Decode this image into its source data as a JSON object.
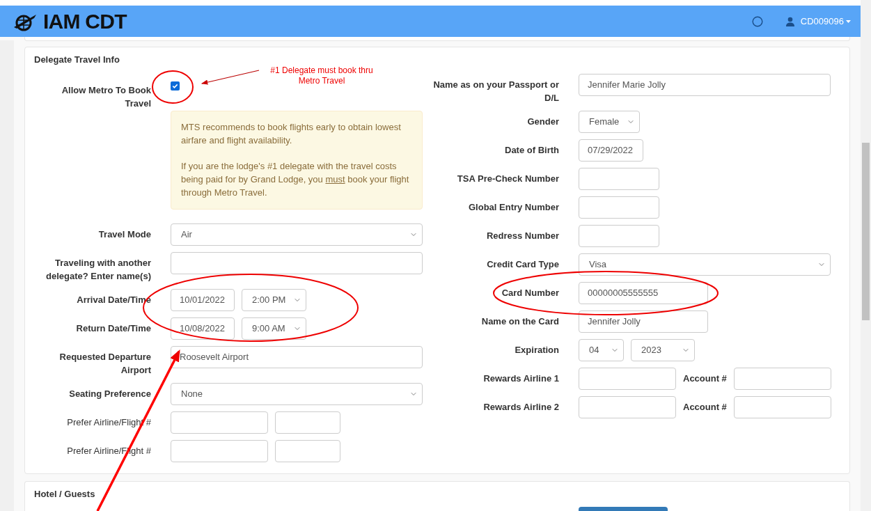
{
  "navbar": {
    "brand": "IAM CDT",
    "user": "CD009096"
  },
  "travel": {
    "title": "Delegate Travel Info",
    "left_rows": [
      {
        "label": "Allow Metro To Book Travel",
        "emphasis": true,
        "fields": [
          {
            "kind": "checkbox",
            "checked": true
          }
        ]
      },
      {
        "kind": "alert",
        "paragraphs": [
          [
            {
              "text": "MTS recommends to book flights early to obtain lowest airfare and flight availability.",
              "underline": false
            }
          ],
          [
            {
              "text": "If you are the lodge's #1 delegate with the travel costs being paid for by Grand Lodge, you ",
              "underline": false
            },
            {
              "text": "must",
              "underline": true
            },
            {
              "text": " book your flight through Metro Travel.",
              "underline": false
            }
          ]
        ]
      },
      {
        "label": "Travel Mode",
        "emphasis": true,
        "fields": [
          {
            "kind": "select",
            "value": "Air"
          }
        ]
      },
      {
        "label": "Traveling with another delegate? Enter name(s)",
        "emphasis": true,
        "fields": [
          {
            "kind": "text"
          }
        ]
      },
      {
        "label": "Arrival Date/Time",
        "emphasis": true,
        "fields": [
          {
            "kind": "text",
            "value": "10/01/2022"
          },
          {
            "kind": "select",
            "value": "2:00 PM"
          }
        ]
      },
      {
        "label": "Return Date/Time",
        "emphasis": true,
        "fields": [
          {
            "kind": "text",
            "value": "10/08/2022"
          },
          {
            "kind": "select",
            "value": "9:00 AM"
          }
        ]
      },
      {
        "label": "Requested Departure Airport",
        "emphasis": true,
        "fields": [
          {
            "kind": "text",
            "value": "Roosevelt Airport"
          }
        ]
      },
      {
        "label": "Seating Preference",
        "emphasis": true,
        "fields": [
          {
            "kind": "select",
            "value": "None"
          }
        ]
      },
      {
        "label": "Prefer Airline/Flight #",
        "emphasis": false,
        "fields": [
          {
            "kind": "text"
          },
          {
            "kind": "text"
          }
        ]
      },
      {
        "label": "Prefer Airline/Flight #",
        "emphasis": false,
        "fields": [
          {
            "kind": "text"
          },
          {
            "kind": "text"
          }
        ]
      }
    ],
    "right_rows": [
      {
        "label": "Name as on your Passport or D/L",
        "emphasis": true,
        "fields": [
          {
            "kind": "text",
            "value": "Jennifer Marie Jolly"
          }
        ]
      },
      {
        "label": "Gender",
        "emphasis": true,
        "fields": [
          {
            "kind": "select",
            "value": "Female"
          }
        ]
      },
      {
        "label": "Date of Birth",
        "emphasis": true,
        "fields": [
          {
            "kind": "text",
            "value": "07/29/2022"
          }
        ]
      },
      {
        "label": "TSA Pre-Check Number",
        "emphasis": true,
        "fields": [
          {
            "kind": "text"
          }
        ]
      },
      {
        "label": "Global Entry Number",
        "emphasis": true,
        "fields": [
          {
            "kind": "text"
          }
        ]
      },
      {
        "label": "Redress Number",
        "emphasis": true,
        "fields": [
          {
            "kind": "text"
          }
        ]
      },
      {
        "label": "Credit Card Type",
        "emphasis": true,
        "fields": [
          {
            "kind": "select",
            "value": "Visa"
          }
        ]
      },
      {
        "label": "Card Number",
        "emphasis": true,
        "fields": [
          {
            "kind": "text",
            "value": "00000005555555"
          }
        ]
      },
      {
        "label": "Name on the Card",
        "emphasis": true,
        "fields": [
          {
            "kind": "text",
            "value": "Jennifer Jolly"
          }
        ]
      },
      {
        "label": "Expiration",
        "emphasis": true,
        "fields": [
          {
            "kind": "select",
            "value": "04"
          },
          {
            "kind": "select",
            "value": "2023"
          }
        ]
      },
      {
        "label": "Rewards Airline 1",
        "emphasis": true,
        "fields": [
          {
            "kind": "text"
          },
          {
            "kind": "label",
            "text": "Account #"
          },
          {
            "kind": "text"
          }
        ]
      },
      {
        "label": "Rewards Airline 2",
        "emphasis": true,
        "fields": [
          {
            "kind": "text"
          },
          {
            "kind": "label",
            "text": "Account #"
          },
          {
            "kind": "text"
          }
        ]
      }
    ]
  },
  "hotel": {
    "title": "Hotel / Guests"
  },
  "annotations": [
    {
      "kind": "note",
      "text": "#1 Delegate must book thru Metro Travel"
    }
  ]
}
